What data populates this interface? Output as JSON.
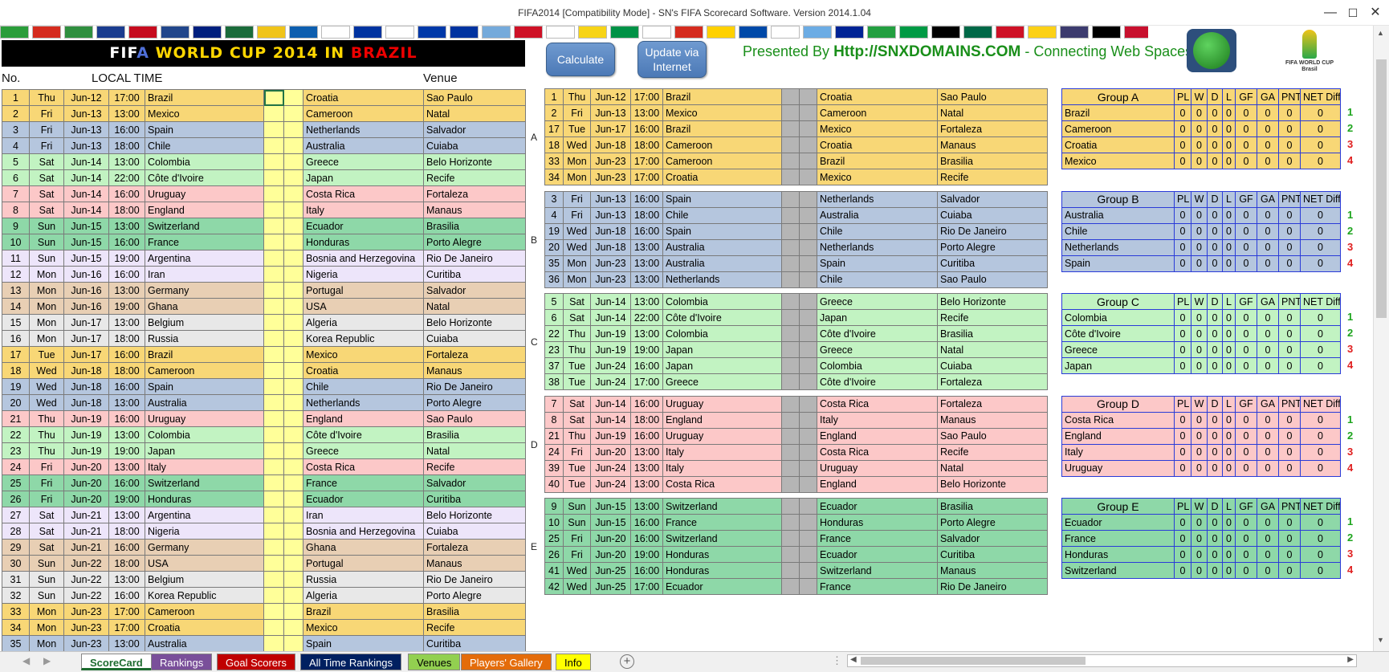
{
  "window": {
    "title": "FIFA2014  [Compatibility Mode] - SN's FIFA Scorecard Software.  Version 2014.1.04"
  },
  "banner": {
    "p1": "FIF",
    "p2": "A",
    "p3": " WORLD CUP 2014 IN ",
    "p4": "BRAZIL"
  },
  "toolbar": {
    "calculate": "Calculate",
    "update": "Update via\nInternet",
    "presented_prefix": "Presented By ",
    "presented_domain": "Http://SNXDOMAINS.COM",
    "presented_suffix": " - Connecting Web Spaces"
  },
  "logo": {
    "text": "FIFA WORLD CUP Brasil"
  },
  "flags": [
    "#2a9d3a",
    "#d52b1e",
    "#2f8f3f",
    "#1a3c8f",
    "#c60b1e",
    "#21468b",
    "#001f7e",
    "#1a6b3a",
    "#f0c419",
    "#0d5eaf",
    "#ffffff",
    "#0033a0",
    "#ffffff",
    "#0038a8",
    "#0033a0",
    "#75aadb",
    "#ce1126",
    "#ffffff",
    "#f7d417",
    "#009246",
    "#ffffff",
    "#d52b1e",
    "#ffd100",
    "#0049a8",
    "#ffffff",
    "#6cace4",
    "#002395",
    "#239f40",
    "#009a44",
    "#000000",
    "#006847",
    "#ce1126",
    "#fcd116",
    "#3c3b6e",
    "#000000",
    "#c8102e",
    "#006233",
    "#0039a6",
    "#ffffff"
  ],
  "colors": {
    "A": "#f8d776",
    "B": "#b5c6de",
    "C": "#c2f3c2",
    "D": "#fcc8c8",
    "E": "#8ed8a8",
    "F": "#ede5fa",
    "G": "#e8cfb4",
    "H": "#e8e8e8",
    "rank_green": "#1ea51e",
    "rank_red": "#e02020"
  },
  "left_table": {
    "h_no": "No.",
    "h_local_time": "LOCAL TIME",
    "h_venue": "Venue",
    "rows": [
      {
        "no": "1",
        "day": "Thu",
        "date": "Jun-12",
        "time": "17:00",
        "home": "Brazil",
        "away": "Croatia",
        "venue": "Sao Paulo",
        "g": "A"
      },
      {
        "no": "2",
        "day": "Fri",
        "date": "Jun-13",
        "time": "13:00",
        "home": "Mexico",
        "away": "Cameroon",
        "venue": "Natal",
        "g": "A"
      },
      {
        "no": "3",
        "day": "Fri",
        "date": "Jun-13",
        "time": "16:00",
        "home": "Spain",
        "away": "Netherlands",
        "venue": "Salvador",
        "g": "B"
      },
      {
        "no": "4",
        "day": "Fri",
        "date": "Jun-13",
        "time": "18:00",
        "home": "Chile",
        "away": "Australia",
        "venue": "Cuiaba",
        "g": "B"
      },
      {
        "no": "5",
        "day": "Sat",
        "date": "Jun-14",
        "time": "13:00",
        "home": "Colombia",
        "away": "Greece",
        "venue": "Belo Horizonte",
        "g": "C"
      },
      {
        "no": "6",
        "day": "Sat",
        "date": "Jun-14",
        "time": "22:00",
        "home": "Côte d'Ivoire",
        "away": "Japan",
        "venue": "Recife",
        "g": "C"
      },
      {
        "no": "7",
        "day": "Sat",
        "date": "Jun-14",
        "time": "16:00",
        "home": "Uruguay",
        "away": "Costa Rica",
        "venue": "Fortaleza",
        "g": "D"
      },
      {
        "no": "8",
        "day": "Sat",
        "date": "Jun-14",
        "time": "18:00",
        "home": "England",
        "away": "Italy",
        "venue": "Manaus",
        "g": "D"
      },
      {
        "no": "9",
        "day": "Sun",
        "date": "Jun-15",
        "time": "13:00",
        "home": "Switzerland",
        "away": "Ecuador",
        "venue": "Brasilia",
        "g": "E"
      },
      {
        "no": "10",
        "day": "Sun",
        "date": "Jun-15",
        "time": "16:00",
        "home": "France",
        "away": "Honduras",
        "venue": "Porto Alegre",
        "g": "E"
      },
      {
        "no": "11",
        "day": "Sun",
        "date": "Jun-15",
        "time": "19:00",
        "home": "Argentina",
        "away": "Bosnia and Herzegovina",
        "venue": "Rio De Janeiro",
        "g": "F"
      },
      {
        "no": "12",
        "day": "Mon",
        "date": "Jun-16",
        "time": "16:00",
        "home": "Iran",
        "away": "Nigeria",
        "venue": "Curitiba",
        "g": "F"
      },
      {
        "no": "13",
        "day": "Mon",
        "date": "Jun-16",
        "time": "13:00",
        "home": "Germany",
        "away": "Portugal",
        "venue": "Salvador",
        "g": "G"
      },
      {
        "no": "14",
        "day": "Mon",
        "date": "Jun-16",
        "time": "19:00",
        "home": "Ghana",
        "away": "USA",
        "venue": "Natal",
        "g": "G"
      },
      {
        "no": "15",
        "day": "Mon",
        "date": "Jun-17",
        "time": "13:00",
        "home": "Belgium",
        "away": "Algeria",
        "venue": "Belo Horizonte",
        "g": "H"
      },
      {
        "no": "16",
        "day": "Mon",
        "date": "Jun-17",
        "time": "18:00",
        "home": "Russia",
        "away": "Korea Republic",
        "venue": "Cuiaba",
        "g": "H"
      },
      {
        "no": "17",
        "day": "Tue",
        "date": "Jun-17",
        "time": "16:00",
        "home": "Brazil",
        "away": "Mexico",
        "venue": "Fortaleza",
        "g": "A"
      },
      {
        "no": "18",
        "day": "Wed",
        "date": "Jun-18",
        "time": "18:00",
        "home": "Cameroon",
        "away": "Croatia",
        "venue": "Manaus",
        "g": "A"
      },
      {
        "no": "19",
        "day": "Wed",
        "date": "Jun-18",
        "time": "16:00",
        "home": "Spain",
        "away": "Chile",
        "venue": "Rio De Janeiro",
        "g": "B"
      },
      {
        "no": "20",
        "day": "Wed",
        "date": "Jun-18",
        "time": "13:00",
        "home": "Australia",
        "away": "Netherlands",
        "venue": "Porto Alegre",
        "g": "B"
      },
      {
        "no": "21",
        "day": "Thu",
        "date": "Jun-19",
        "time": "16:00",
        "home": "Uruguay",
        "away": "England",
        "venue": "Sao Paulo",
        "g": "D"
      },
      {
        "no": "22",
        "day": "Thu",
        "date": "Jun-19",
        "time": "13:00",
        "home": "Colombia",
        "away": "Côte d'Ivoire",
        "venue": "Brasilia",
        "g": "C"
      },
      {
        "no": "23",
        "day": "Thu",
        "date": "Jun-19",
        "time": "19:00",
        "home": "Japan",
        "away": "Greece",
        "venue": "Natal",
        "g": "C"
      },
      {
        "no": "24",
        "day": "Fri",
        "date": "Jun-20",
        "time": "13:00",
        "home": "Italy",
        "away": "Costa Rica",
        "venue": "Recife",
        "g": "D"
      },
      {
        "no": "25",
        "day": "Fri",
        "date": "Jun-20",
        "time": "16:00",
        "home": "Switzerland",
        "away": "France",
        "venue": "Salvador",
        "g": "E"
      },
      {
        "no": "26",
        "day": "Fri",
        "date": "Jun-20",
        "time": "19:00",
        "home": "Honduras",
        "away": "Ecuador",
        "venue": "Curitiba",
        "g": "E"
      },
      {
        "no": "27",
        "day": "Sat",
        "date": "Jun-21",
        "time": "13:00",
        "home": "Argentina",
        "away": "Iran",
        "venue": "Belo Horizonte",
        "g": "F"
      },
      {
        "no": "28",
        "day": "Sat",
        "date": "Jun-21",
        "time": "18:00",
        "home": "Nigeria",
        "away": "Bosnia and Herzegovina",
        "venue": "Cuiaba",
        "g": "F"
      },
      {
        "no": "29",
        "day": "Sat",
        "date": "Jun-21",
        "time": "16:00",
        "home": "Germany",
        "away": "Ghana",
        "venue": "Fortaleza",
        "g": "G"
      },
      {
        "no": "30",
        "day": "Sun",
        "date": "Jun-22",
        "time": "18:00",
        "home": "USA",
        "away": "Portugal",
        "venue": "Manaus",
        "g": "G"
      },
      {
        "no": "31",
        "day": "Sun",
        "date": "Jun-22",
        "time": "13:00",
        "home": "Belgium",
        "away": "Russia",
        "venue": "Rio De Janeiro",
        "g": "H"
      },
      {
        "no": "32",
        "day": "Sun",
        "date": "Jun-22",
        "time": "16:00",
        "home": "Korea Republic",
        "away": "Algeria",
        "venue": "Porto Alegre",
        "g": "H"
      },
      {
        "no": "33",
        "day": "Mon",
        "date": "Jun-23",
        "time": "17:00",
        "home": "Cameroon",
        "away": "Brazil",
        "venue": "Brasilia",
        "g": "A"
      },
      {
        "no": "34",
        "day": "Mon",
        "date": "Jun-23",
        "time": "17:00",
        "home": "Croatia",
        "away": "Mexico",
        "venue": "Recife",
        "g": "A"
      },
      {
        "no": "35",
        "day": "Mon",
        "date": "Jun-23",
        "time": "13:00",
        "home": "Australia",
        "away": "Spain",
        "venue": "Curitiba",
        "g": "B"
      }
    ]
  },
  "standings_headers": [
    "PL",
    "W",
    "D",
    "L",
    "GF",
    "GA",
    "PNT",
    "NET Diff"
  ],
  "groups": [
    {
      "letter": "A",
      "title": "Group A",
      "g": "A",
      "matches": [
        {
          "no": "1",
          "day": "Thu",
          "date": "Jun-12",
          "time": "17:00",
          "home": "Brazil",
          "away": "Croatia",
          "venue": "Sao Paulo"
        },
        {
          "no": "2",
          "day": "Fri",
          "date": "Jun-13",
          "time": "13:00",
          "home": "Mexico",
          "away": "Cameroon",
          "venue": "Natal"
        },
        {
          "no": "17",
          "day": "Tue",
          "date": "Jun-17",
          "time": "16:00",
          "home": "Brazil",
          "away": "Mexico",
          "venue": "Fortaleza"
        },
        {
          "no": "18",
          "day": "Wed",
          "date": "Jun-18",
          "time": "18:00",
          "home": "Cameroon",
          "away": "Croatia",
          "venue": "Manaus"
        },
        {
          "no": "33",
          "day": "Mon",
          "date": "Jun-23",
          "time": "17:00",
          "home": "Cameroon",
          "away": "Brazil",
          "venue": "Brasilia"
        },
        {
          "no": "34",
          "day": "Mon",
          "date": "Jun-23",
          "time": "17:00",
          "home": "Croatia",
          "away": "Mexico",
          "venue": "Recife"
        }
      ],
      "teams": [
        "Brazil",
        "Cameroon",
        "Croatia",
        "Mexico"
      ]
    },
    {
      "letter": "B",
      "title": "Group B",
      "g": "B",
      "matches": [
        {
          "no": "3",
          "day": "Fri",
          "date": "Jun-13",
          "time": "16:00",
          "home": "Spain",
          "away": "Netherlands",
          "venue": "Salvador"
        },
        {
          "no": "4",
          "day": "Fri",
          "date": "Jun-13",
          "time": "18:00",
          "home": "Chile",
          "away": "Australia",
          "venue": "Cuiaba"
        },
        {
          "no": "19",
          "day": "Wed",
          "date": "Jun-18",
          "time": "16:00",
          "home": "Spain",
          "away": "Chile",
          "venue": "Rio De Janeiro"
        },
        {
          "no": "20",
          "day": "Wed",
          "date": "Jun-18",
          "time": "13:00",
          "home": "Australia",
          "away": "Netherlands",
          "venue": "Porto Alegre"
        },
        {
          "no": "35",
          "day": "Mon",
          "date": "Jun-23",
          "time": "13:00",
          "home": "Australia",
          "away": "Spain",
          "venue": "Curitiba"
        },
        {
          "no": "36",
          "day": "Mon",
          "date": "Jun-23",
          "time": "13:00",
          "home": "Netherlands",
          "away": "Chile",
          "venue": "Sao Paulo"
        }
      ],
      "teams": [
        "Australia",
        "Chile",
        "Netherlands",
        "Spain"
      ]
    },
    {
      "letter": "C",
      "title": "Group C",
      "g": "C",
      "matches": [
        {
          "no": "5",
          "day": "Sat",
          "date": "Jun-14",
          "time": "13:00",
          "home": "Colombia",
          "away": "Greece",
          "venue": "Belo Horizonte"
        },
        {
          "no": "6",
          "day": "Sat",
          "date": "Jun-14",
          "time": "22:00",
          "home": "Côte d'Ivoire",
          "away": "Japan",
          "venue": "Recife"
        },
        {
          "no": "22",
          "day": "Thu",
          "date": "Jun-19",
          "time": "13:00",
          "home": "Colombia",
          "away": "Côte d'Ivoire",
          "venue": "Brasilia"
        },
        {
          "no": "23",
          "day": "Thu",
          "date": "Jun-19",
          "time": "19:00",
          "home": "Japan",
          "away": "Greece",
          "venue": "Natal"
        },
        {
          "no": "37",
          "day": "Tue",
          "date": "Jun-24",
          "time": "16:00",
          "home": "Japan",
          "away": "Colombia",
          "venue": "Cuiaba"
        },
        {
          "no": "38",
          "day": "Tue",
          "date": "Jun-24",
          "time": "17:00",
          "home": "Greece",
          "away": "Côte d'Ivoire",
          "venue": "Fortaleza"
        }
      ],
      "teams": [
        "Colombia",
        "Côte d'Ivoire",
        "Greece",
        "Japan"
      ]
    },
    {
      "letter": "D",
      "title": "Group D",
      "g": "D",
      "matches": [
        {
          "no": "7",
          "day": "Sat",
          "date": "Jun-14",
          "time": "16:00",
          "home": "Uruguay",
          "away": "Costa Rica",
          "venue": "Fortaleza"
        },
        {
          "no": "8",
          "day": "Sat",
          "date": "Jun-14",
          "time": "18:00",
          "home": "England",
          "away": "Italy",
          "venue": "Manaus"
        },
        {
          "no": "21",
          "day": "Thu",
          "date": "Jun-19",
          "time": "16:00",
          "home": "Uruguay",
          "away": "England",
          "venue": "Sao Paulo"
        },
        {
          "no": "24",
          "day": "Fri",
          "date": "Jun-20",
          "time": "13:00",
          "home": "Italy",
          "away": "Costa Rica",
          "venue": "Recife"
        },
        {
          "no": "39",
          "day": "Tue",
          "date": "Jun-24",
          "time": "13:00",
          "home": "Italy",
          "away": "Uruguay",
          "venue": "Natal"
        },
        {
          "no": "40",
          "day": "Tue",
          "date": "Jun-24",
          "time": "13:00",
          "home": "Costa Rica",
          "away": "England",
          "venue": "Belo Horizonte"
        }
      ],
      "teams": [
        "Costa Rica",
        "England",
        "Italy",
        "Uruguay"
      ]
    },
    {
      "letter": "E",
      "title": "Group E",
      "g": "E",
      "matches": [
        {
          "no": "9",
          "day": "Sun",
          "date": "Jun-15",
          "time": "13:00",
          "home": "Switzerland",
          "away": "Ecuador",
          "venue": "Brasilia"
        },
        {
          "no": "10",
          "day": "Sun",
          "date": "Jun-15",
          "time": "16:00",
          "home": "France",
          "away": "Honduras",
          "venue": "Porto Alegre"
        },
        {
          "no": "25",
          "day": "Fri",
          "date": "Jun-20",
          "time": "16:00",
          "home": "Switzerland",
          "away": "France",
          "venue": "Salvador"
        },
        {
          "no": "26",
          "day": "Fri",
          "date": "Jun-20",
          "time": "19:00",
          "home": "Honduras",
          "away": "Ecuador",
          "venue": "Curitiba"
        },
        {
          "no": "41",
          "day": "Wed",
          "date": "Jun-25",
          "time": "16:00",
          "home": "Honduras",
          "away": "Switzerland",
          "venue": "Manaus"
        },
        {
          "no": "42",
          "day": "Wed",
          "date": "Jun-25",
          "time": "17:00",
          "home": "Ecuador",
          "away": "France",
          "venue": "Rio De Janeiro"
        }
      ],
      "teams": [
        "Ecuador",
        "France",
        "Honduras",
        "Switzerland"
      ]
    }
  ],
  "sheet_tabs": [
    {
      "label": "ScoreCard",
      "bg": "#ffffff",
      "fg": "#1d6b2f",
      "active": true
    },
    {
      "label": "Rankings",
      "bg": "#7a4f9a",
      "fg": "#ffffff"
    },
    {
      "label": "Goal Scorers",
      "bg": "#c00000",
      "fg": "#ffffff"
    },
    {
      "label": "All Time Rankings",
      "bg": "#002060",
      "fg": "#ffffff"
    },
    {
      "label": "Venues",
      "bg": "#92d050",
      "fg": "#000000"
    },
    {
      "label": "Players' Gallery",
      "bg": "#e46c0a",
      "fg": "#ffffff"
    },
    {
      "label": "Info",
      "bg": "#ffff00",
      "fg": "#000000"
    }
  ]
}
